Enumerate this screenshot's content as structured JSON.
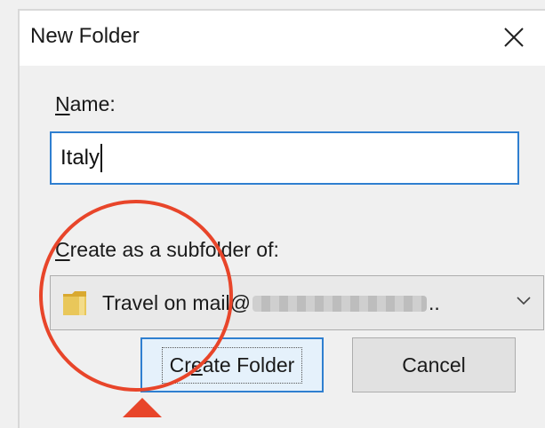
{
  "dialog": {
    "title": "New Folder",
    "close_icon": "close-icon"
  },
  "name_field": {
    "label_accel": "N",
    "label_rest": "ame:",
    "value": "Italy"
  },
  "subfolder": {
    "label_accel": "C",
    "label_rest": "reate as a subfolder of:",
    "selected_prefix": "Travel on mail@",
    "selected_suffix": "..",
    "icon": "folder-icon"
  },
  "buttons": {
    "create_accel_pre": "Cr",
    "create_accel": "e",
    "create_accel_post": "ate Folder",
    "cancel": "Cancel"
  },
  "colors": {
    "focus_blue": "#2f7fd0",
    "annotation_red": "#e8452a",
    "folder_yellow": "#e9c75a"
  }
}
